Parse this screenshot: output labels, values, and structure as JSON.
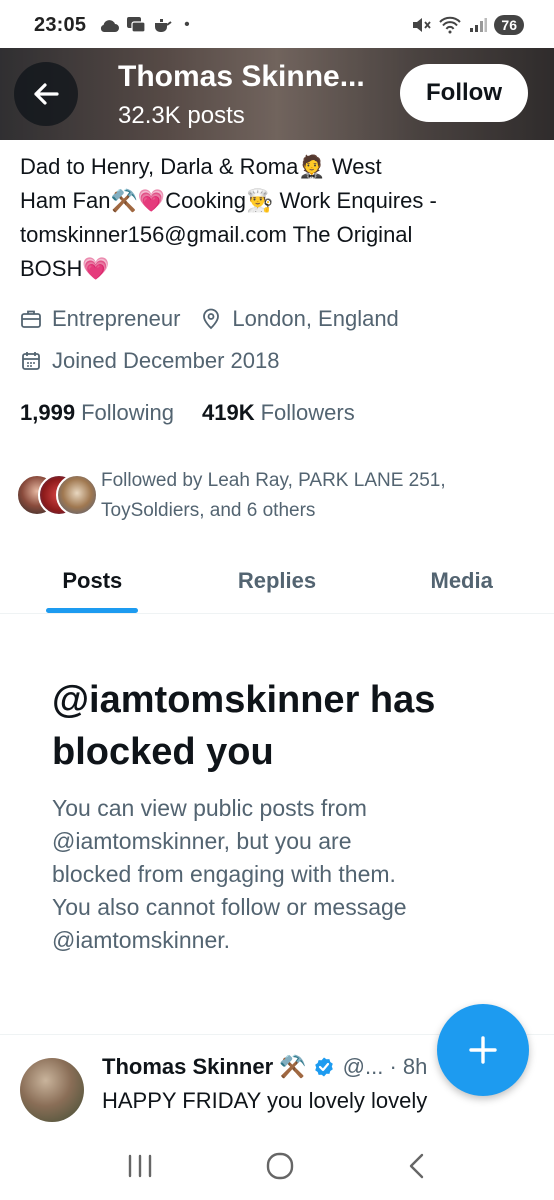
{
  "status_bar": {
    "time": "23:05",
    "dot": "•",
    "battery": "76",
    "icons_left": [
      "cloud-icon",
      "chat-icon",
      "teapot-icon"
    ],
    "icons_right": [
      "mute-icon",
      "wifi-icon",
      "signal-icon"
    ]
  },
  "header": {
    "name": "Thomas Skinne...",
    "posts": "32.3K posts",
    "follow_label": "Follow"
  },
  "bio": {
    "lines": [
      "Dad to Henry, Darla & Roma🤵 West",
      "Ham Fan⚒️💗Cooking👨‍🍳 Work Enquires -",
      "tomskinner156@gmail.com The Original",
      "BOSH💗"
    ],
    "occupation": "Entrepreneur",
    "location": "London, England",
    "joined": "Joined December 2018"
  },
  "stats": {
    "following_count": "1,999",
    "following_label": "Following",
    "followers_count": "419K",
    "followers_label": "Followers"
  },
  "followed_by": {
    "line1": "Followed by Leah Ray, PARK LANE 251,",
    "line2": "ToySoldiers, and 6 others"
  },
  "tabs": [
    {
      "label": "Posts",
      "active": true
    },
    {
      "label": "Replies",
      "active": false
    },
    {
      "label": "Media",
      "active": false
    }
  ],
  "blocked": {
    "title_line1": "@iamtomskinner has",
    "title_line2": "blocked you",
    "desc_lines": [
      "You can view public posts from",
      "@iamtomskinner, but you are",
      "blocked from engaging with them.",
      "You also cannot follow or message",
      "@iamtomskinner."
    ]
  },
  "tweet": {
    "name": "Thomas Skinner ⚒️",
    "handle": "@... · 8h",
    "text": "HAPPY FRIDAY you lovely lovely"
  },
  "colors": {
    "accent": "#1d9bf0",
    "text_primary": "#0f1419",
    "text_secondary": "#536471"
  }
}
